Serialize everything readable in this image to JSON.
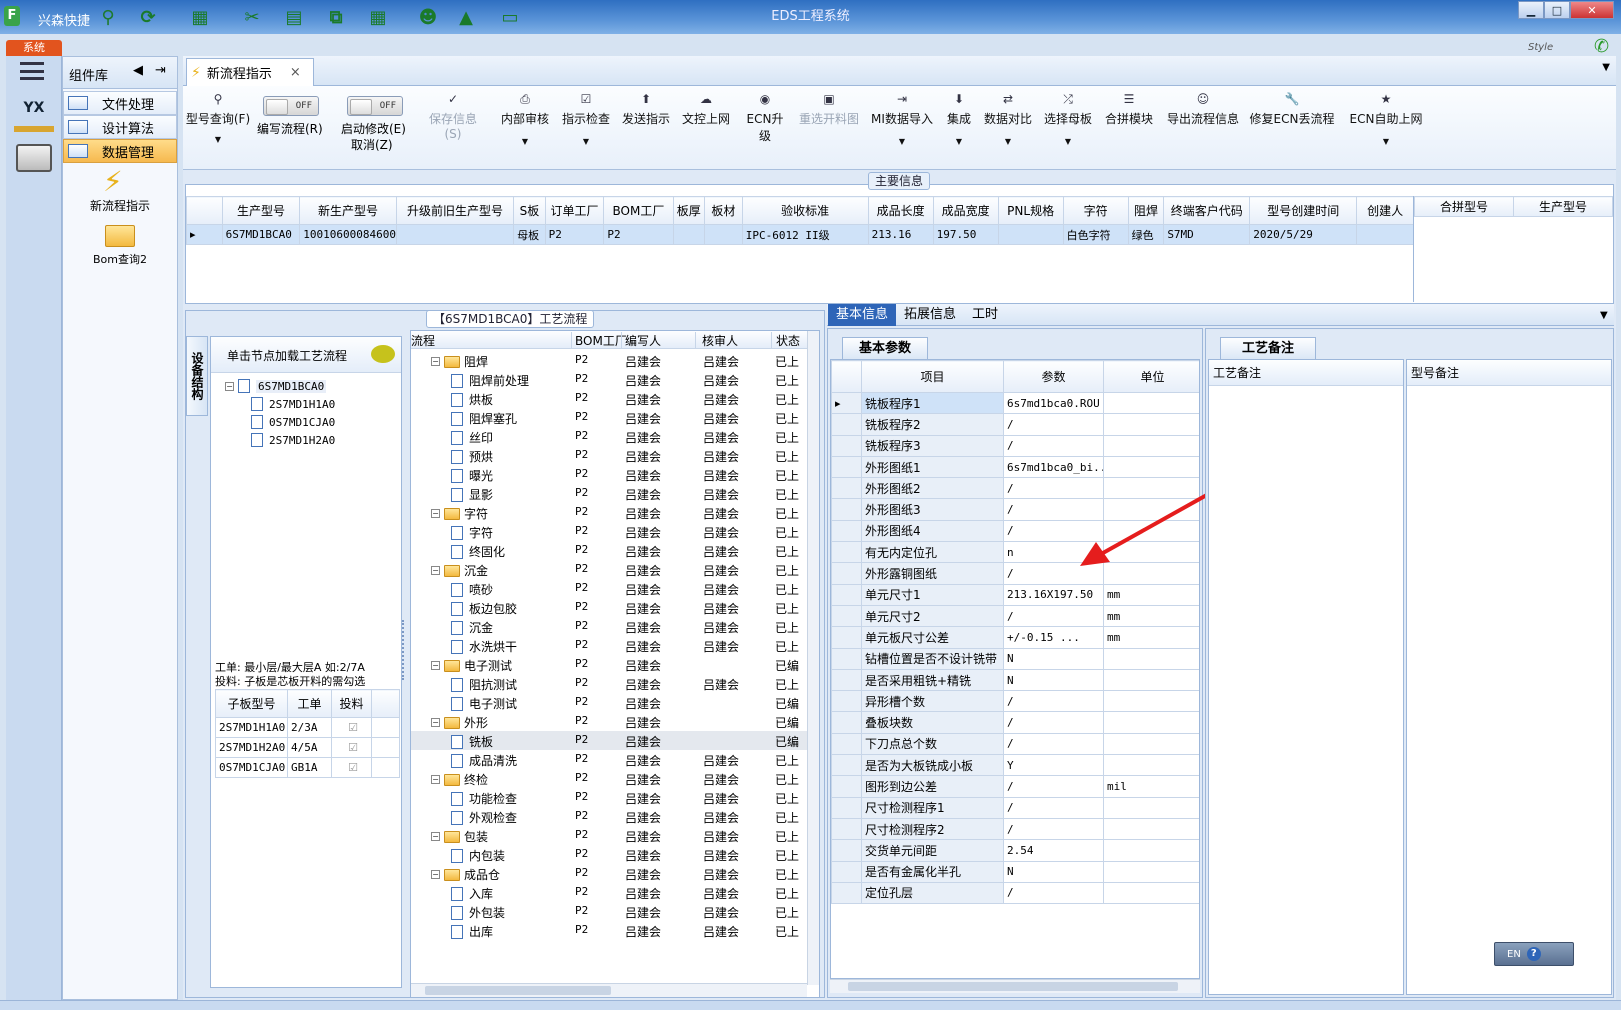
{
  "window": {
    "title": "EDS工程系统",
    "app_label": "兴森快捷",
    "style_label": "Style",
    "min": "▁",
    "max": "□",
    "close": "✕"
  },
  "systab": "系统",
  "leftbar": {
    "yx": "YX"
  },
  "complib": {
    "title": "组件库",
    "items": [
      "文件处理",
      "设计算法",
      "数据管理"
    ],
    "shortcuts": [
      "新流程指示",
      "Bom查询2"
    ]
  },
  "doctab": {
    "label": "新流程指示",
    "close": "×"
  },
  "ribbon": {
    "query": "型号查询(F)",
    "toggle1": {
      "state": "OFF",
      "label": "编写流程(R)"
    },
    "toggle2": {
      "state": "OFF",
      "label": "启动修改(E)",
      "sub": "取消(Z)"
    },
    "buttons": [
      "保存信息(S)",
      "内部审核",
      "指示检查",
      "发送指示",
      "文控上网",
      "ECN升级",
      "重选开料图",
      "MI数据导入",
      "集成",
      "数据对比",
      "选择母板",
      "合拼模块",
      "导出流程信息",
      "修复ECN丢流程",
      "ECN自助上网"
    ]
  },
  "main_info": {
    "caption": "主要信息",
    "headers": [
      "生产型号",
      "新生产型号",
      "升级前旧生产型号",
      "S板",
      "订单工厂",
      "BOM工厂",
      "板厚",
      "板材",
      "验收标准",
      "成品长度",
      "成品宽度",
      "PNL规格",
      "字符",
      "阻焊",
      "终端客户代码",
      "型号创建时间",
      "创建人"
    ],
    "row": [
      "6S7MD1BCA0",
      "10010600084600",
      "",
      "母板",
      "P2",
      "P2",
      "",
      "",
      "IPC-6012 II级",
      "213.16",
      "197.50",
      "",
      "白色字符",
      "绿色",
      "S7MD",
      "2020/5/29",
      ""
    ],
    "side_headers": [
      "合拼型号",
      "生产型号"
    ]
  },
  "process": {
    "caption": "【6S7MD1BCA0】工艺流程",
    "side_tab": "设备结构",
    "hint": "单击节点加载工艺流程",
    "tree_root": "6S7MD1BCA0",
    "tree_children": [
      "2S7MD1H1A0",
      "0S7MD1CJA0",
      "2S7MD1H2A0"
    ],
    "note1": "工单: 最小层/最大层A 如:2/7A",
    "note2": "投料: 子板是芯板开料的需勾选",
    "sub_headers": [
      "子板型号",
      "工单",
      "投料"
    ],
    "sub_rows": [
      [
        "2S7MD1H1A0",
        "2/3A"
      ],
      [
        "2S7MD1H2A0",
        "4/5A"
      ],
      [
        "0S7MD1CJA0",
        "GB1A"
      ]
    ],
    "flow_headers": [
      "流程",
      "BOM工厂",
      "编写人",
      "核审人",
      "状态"
    ],
    "flow": [
      {
        "n": "阻焊",
        "g": 1,
        "b": "P2",
        "w": "吕建会",
        "r": "吕建会",
        "s": "已上"
      },
      {
        "n": "阻焊前处理",
        "g": 0,
        "b": "P2",
        "w": "吕建会",
        "r": "吕建会",
        "s": "已上"
      },
      {
        "n": "烘板",
        "g": 0,
        "b": "P2",
        "w": "吕建会",
        "r": "吕建会",
        "s": "已上"
      },
      {
        "n": "阻焊塞孔",
        "g": 0,
        "b": "P2",
        "w": "吕建会",
        "r": "吕建会",
        "s": "已上"
      },
      {
        "n": "丝印",
        "g": 0,
        "b": "P2",
        "w": "吕建会",
        "r": "吕建会",
        "s": "已上"
      },
      {
        "n": "预烘",
        "g": 0,
        "b": "P2",
        "w": "吕建会",
        "r": "吕建会",
        "s": "已上"
      },
      {
        "n": "曝光",
        "g": 0,
        "b": "P2",
        "w": "吕建会",
        "r": "吕建会",
        "s": "已上"
      },
      {
        "n": "显影",
        "g": 0,
        "b": "P2",
        "w": "吕建会",
        "r": "吕建会",
        "s": "已上"
      },
      {
        "n": "字符",
        "g": 1,
        "b": "P2",
        "w": "吕建会",
        "r": "吕建会",
        "s": "已上"
      },
      {
        "n": "字符",
        "g": 0,
        "b": "P2",
        "w": "吕建会",
        "r": "吕建会",
        "s": "已上"
      },
      {
        "n": "终固化",
        "g": 0,
        "b": "P2",
        "w": "吕建会",
        "r": "吕建会",
        "s": "已上"
      },
      {
        "n": "沉金",
        "g": 1,
        "b": "P2",
        "w": "吕建会",
        "r": "吕建会",
        "s": "已上"
      },
      {
        "n": "喷砂",
        "g": 0,
        "b": "P2",
        "w": "吕建会",
        "r": "吕建会",
        "s": "已上"
      },
      {
        "n": "板边包胶",
        "g": 0,
        "b": "P2",
        "w": "吕建会",
        "r": "吕建会",
        "s": "已上"
      },
      {
        "n": "沉金",
        "g": 0,
        "b": "P2",
        "w": "吕建会",
        "r": "吕建会",
        "s": "已上"
      },
      {
        "n": "水洗烘干",
        "g": 0,
        "b": "P2",
        "w": "吕建会",
        "r": "吕建会",
        "s": "已上"
      },
      {
        "n": "电子测试",
        "g": 1,
        "b": "P2",
        "w": "吕建会",
        "r": "",
        "s": "已编"
      },
      {
        "n": "阻抗测试",
        "g": 0,
        "b": "P2",
        "w": "吕建会",
        "r": "吕建会",
        "s": "已上"
      },
      {
        "n": "电子测试",
        "g": 0,
        "b": "P2",
        "w": "吕建会",
        "r": "",
        "s": "已编"
      },
      {
        "n": "外形",
        "g": 1,
        "b": "P2",
        "w": "吕建会",
        "r": "",
        "s": "已编"
      },
      {
        "n": "铣板",
        "g": 0,
        "b": "P2",
        "w": "吕建会",
        "r": "",
        "s": "已编"
      },
      {
        "n": "成品清洗",
        "g": 0,
        "b": "P2",
        "w": "吕建会",
        "r": "吕建会",
        "s": "已上"
      },
      {
        "n": "终检",
        "g": 1,
        "b": "P2",
        "w": "吕建会",
        "r": "吕建会",
        "s": "已上"
      },
      {
        "n": "功能检查",
        "g": 0,
        "b": "P2",
        "w": "吕建会",
        "r": "吕建会",
        "s": "已上"
      },
      {
        "n": "外观检查",
        "g": 0,
        "b": "P2",
        "w": "吕建会",
        "r": "吕建会",
        "s": "已上"
      },
      {
        "n": "包装",
        "g": 1,
        "b": "P2",
        "w": "吕建会",
        "r": "吕建会",
        "s": "已上"
      },
      {
        "n": "内包装",
        "g": 0,
        "b": "P2",
        "w": "吕建会",
        "r": "吕建会",
        "s": "已上"
      },
      {
        "n": "成品仓",
        "g": 1,
        "b": "P2",
        "w": "吕建会",
        "r": "吕建会",
        "s": "已上"
      },
      {
        "n": "入库",
        "g": 0,
        "b": "P2",
        "w": "吕建会",
        "r": "吕建会",
        "s": "已上"
      },
      {
        "n": "外包装",
        "g": 0,
        "b": "P2",
        "w": "吕建会",
        "r": "吕建会",
        "s": "已上"
      },
      {
        "n": "出库",
        "g": 0,
        "b": "P2",
        "w": "吕建会",
        "r": "吕建会",
        "s": "已上"
      }
    ]
  },
  "right_tabs": [
    "基本信息",
    "拓展信息",
    "工时"
  ],
  "basic": {
    "tab": "基本参数",
    "headers": [
      "项目",
      "参数",
      "单位"
    ],
    "rows": [
      [
        "铣板程序1",
        "6s7md1bca0.ROU",
        ""
      ],
      [
        "铣板程序2",
        "/",
        ""
      ],
      [
        "铣板程序3",
        "/",
        ""
      ],
      [
        "外形图纸1",
        "6s7md1bca0_bi...",
        ""
      ],
      [
        "外形图纸2",
        "/",
        ""
      ],
      [
        "外形图纸3",
        "/",
        ""
      ],
      [
        "外形图纸4",
        "/",
        ""
      ],
      [
        "有无内定位孔",
        "n",
        ""
      ],
      [
        "外形露铜图纸",
        "/",
        ""
      ],
      [
        "单元尺寸1",
        "213.16X197.50",
        "mm"
      ],
      [
        "单元尺寸2",
        "/",
        "mm"
      ],
      [
        "单元板尺寸公差",
        "+/-0.15      ...",
        "mm"
      ],
      [
        "钻槽位置是否不设计铣带",
        "N",
        ""
      ],
      [
        "是否采用粗铣+精铣",
        "N",
        ""
      ],
      [
        "异形槽个数",
        "/",
        ""
      ],
      [
        "叠板块数",
        "/",
        ""
      ],
      [
        "下刀点总个数",
        "/",
        ""
      ],
      [
        "是否为大板铣成小板",
        "Y",
        ""
      ],
      [
        "图形到边公差",
        "/",
        "mil"
      ],
      [
        "尺寸检测程序1",
        "/",
        ""
      ],
      [
        "尺寸检测程序2",
        "/",
        ""
      ],
      [
        "交货单元间距",
        "2.54",
        ""
      ],
      [
        "是否有金属化半孔",
        "N",
        ""
      ],
      [
        "定位孔层",
        "/",
        ""
      ]
    ]
  },
  "remark": {
    "tab": "工艺备注",
    "col1": "工艺备注",
    "col2": "型号备注"
  },
  "lang": {
    "code": "EN",
    "help": "?"
  },
  "colors": {
    "accent": "#e2541e",
    "selection": "#cfe2f8",
    "arrow": "#e51d1d"
  }
}
